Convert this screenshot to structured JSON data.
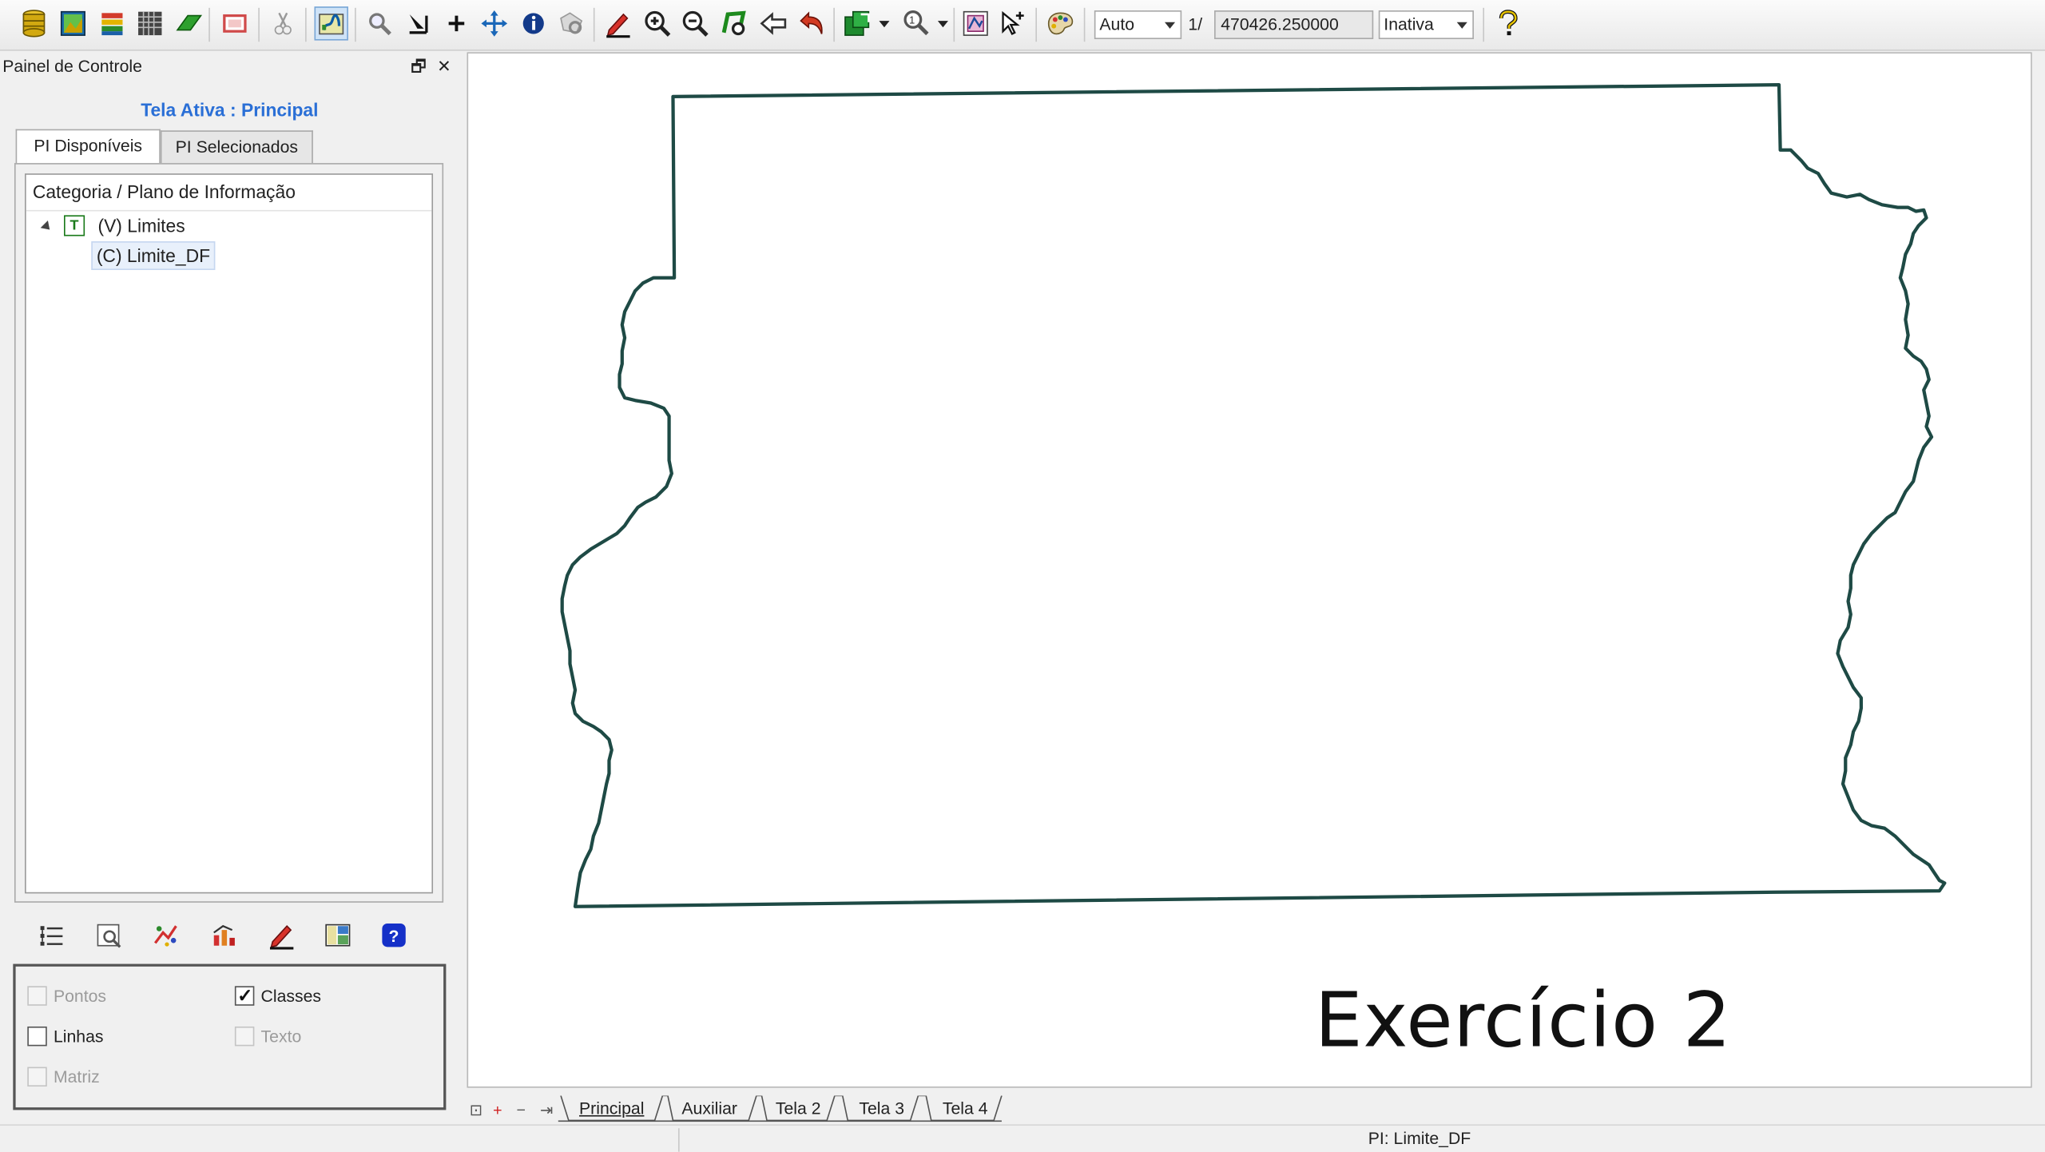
{
  "toolbar": {
    "icons": [
      "database-icon",
      "image-icon",
      "layers-icon",
      "grid-icon",
      "eraser-icon",
      "frame-icon",
      "scissors-icon",
      "map-view-icon",
      "magnifier-icon",
      "cursor-down-icon",
      "plus-icon",
      "move-icon",
      "info-icon",
      "polygon-select-icon",
      "pencil-icon",
      "zoom-in-icon",
      "zoom-out-icon",
      "zoom-area-icon",
      "back-icon",
      "undo-icon",
      "export-icon",
      "zoom-scale-icon",
      "graphic-icon",
      "pointer-plus-icon",
      "palette-icon",
      "help-icon"
    ],
    "zoom_mode": "Auto",
    "scale_prefix": "1/",
    "scale_value": "470426.250000",
    "state_value": "Inativa",
    "colors": {
      "active_button_bg": "#cfe3f7",
      "active_button_border": "#7aa7d6"
    }
  },
  "panel": {
    "title": "Painel de Controle",
    "restore_glyph": "🗗",
    "close_glyph": "✕",
    "active_screen": "Tela Ativa : Principal",
    "active_screen_color": "#2a6fd6",
    "tabs": [
      {
        "label": "PI Disponíveis",
        "selected": true
      },
      {
        "label": "PI Selecionados",
        "selected": false
      }
    ],
    "tree_header": "Categoria / Plano de Informação",
    "tree": {
      "category_icon_letter": "T",
      "category": "(V) Limites",
      "child": "(C) Limite_DF"
    },
    "bottom_tools": [
      "list-icon",
      "preview-icon",
      "style-icon",
      "chart-icon",
      "edit-icon",
      "legend-icon",
      "help-icon"
    ],
    "options": {
      "pontos": {
        "label": "Pontos",
        "checked": false,
        "enabled": false
      },
      "classes": {
        "label": "Classes",
        "checked": true,
        "enabled": true
      },
      "linhas": {
        "label": "Linhas",
        "checked": false,
        "enabled": true
      },
      "texto": {
        "label": "Texto",
        "checked": false,
        "enabled": false
      },
      "matriz": {
        "label": "Matriz",
        "checked": false,
        "enabled": false
      }
    }
  },
  "map": {
    "boundary_color": "#1e4a45",
    "caption": "Exercício 2"
  },
  "sheet_tabs": {
    "controls": [
      "⊡",
      "+",
      "−",
      "⇥"
    ],
    "tabs": [
      {
        "label": "Principal",
        "selected": true
      },
      {
        "label": "Auxiliar",
        "selected": false
      },
      {
        "label": "Tela 2",
        "selected": false
      },
      {
        "label": "Tela 3",
        "selected": false
      },
      {
        "label": "Tela 4",
        "selected": false
      }
    ]
  },
  "status": {
    "pi_text": "PI: Limite_DF"
  }
}
